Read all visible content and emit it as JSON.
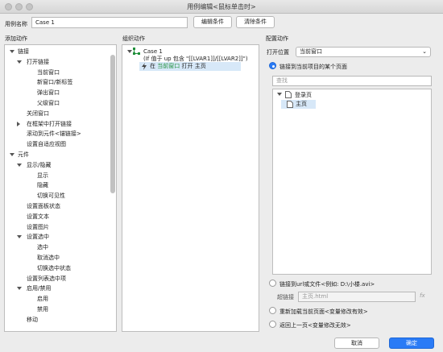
{
  "window": {
    "title": "用例编辑<鼠标单击时>"
  },
  "top": {
    "case_name_label": "用例名称",
    "case_name_value": "Case 1",
    "edit_condition": "编辑条件",
    "clear_condition": "清除条件"
  },
  "sections": {
    "add_action": "添加动作",
    "organize_action": "组织动作",
    "configure_action": "配置动作"
  },
  "actions_tree": [
    {
      "label": "链接",
      "level": 0,
      "arrow": "down"
    },
    {
      "label": "打开链接",
      "level": 1,
      "arrow": "down"
    },
    {
      "label": "当前窗口",
      "level": 2,
      "arrow": ""
    },
    {
      "label": "新窗口/新标签",
      "level": 2,
      "arrow": ""
    },
    {
      "label": "弹出窗口",
      "level": 2,
      "arrow": ""
    },
    {
      "label": "父级窗口",
      "level": 2,
      "arrow": ""
    },
    {
      "label": "关闭窗口",
      "level": 1,
      "arrow": ""
    },
    {
      "label": "在框架中打开链接",
      "level": 1,
      "arrow": "right"
    },
    {
      "label": "滚动到元件<锚链接>",
      "level": 1,
      "arrow": ""
    },
    {
      "label": "设置自适应视图",
      "level": 1,
      "arrow": ""
    },
    {
      "label": "元件",
      "level": 0,
      "arrow": "down"
    },
    {
      "label": "显示/隐藏",
      "level": 1,
      "arrow": "down"
    },
    {
      "label": "显示",
      "level": 2,
      "arrow": ""
    },
    {
      "label": "隐藏",
      "level": 2,
      "arrow": ""
    },
    {
      "label": "切换可见性",
      "level": 2,
      "arrow": ""
    },
    {
      "label": "设置面板状态",
      "level": 1,
      "arrow": ""
    },
    {
      "label": "设置文本",
      "level": 1,
      "arrow": ""
    },
    {
      "label": "设置图片",
      "level": 1,
      "arrow": ""
    },
    {
      "label": "设置选中",
      "level": 1,
      "arrow": "down"
    },
    {
      "label": "选中",
      "level": 2,
      "arrow": ""
    },
    {
      "label": "取消选中",
      "level": 2,
      "arrow": ""
    },
    {
      "label": "切换选中状态",
      "level": 2,
      "arrow": ""
    },
    {
      "label": "设置列表选中项",
      "level": 1,
      "arrow": ""
    },
    {
      "label": "启用/禁用",
      "level": 1,
      "arrow": "down"
    },
    {
      "label": "启用",
      "level": 2,
      "arrow": ""
    },
    {
      "label": "禁用",
      "level": 2,
      "arrow": ""
    },
    {
      "label": "移动",
      "level": 1,
      "arrow": ""
    }
  ],
  "organize": {
    "case_label": "Case 1",
    "condition": "(If 值于 up 包含 \"[[LVAR1]]/[[LVAR2]]\")",
    "action_prefix": "在",
    "action_target": "当前窗口",
    "action_suffix": "打开 主页"
  },
  "config": {
    "open_in_label": "打开位置",
    "open_in_value": "当前窗口",
    "link_to_page": "链接到当前项目的某个页面",
    "search_placeholder": "查找",
    "pages": [
      {
        "label": "登录页"
      },
      {
        "label": "主页"
      }
    ],
    "link_to_url": "链接到url或文件<例如: D:\\小楼.avi>",
    "hyperlink_label": "超链接",
    "hyperlink_placeholder": "主页.html",
    "fx": "fx",
    "reload": "重新加载当前页面<变量修改有效>",
    "back": "返回上一页<变量修改无效>"
  },
  "footer": {
    "cancel": "取消",
    "ok": "确定"
  },
  "colors": {
    "accent": "#2a7bf6",
    "selection": "#d7e8f8",
    "action_green": "#1f8f3a",
    "ok_button": "#2a7bf6"
  }
}
